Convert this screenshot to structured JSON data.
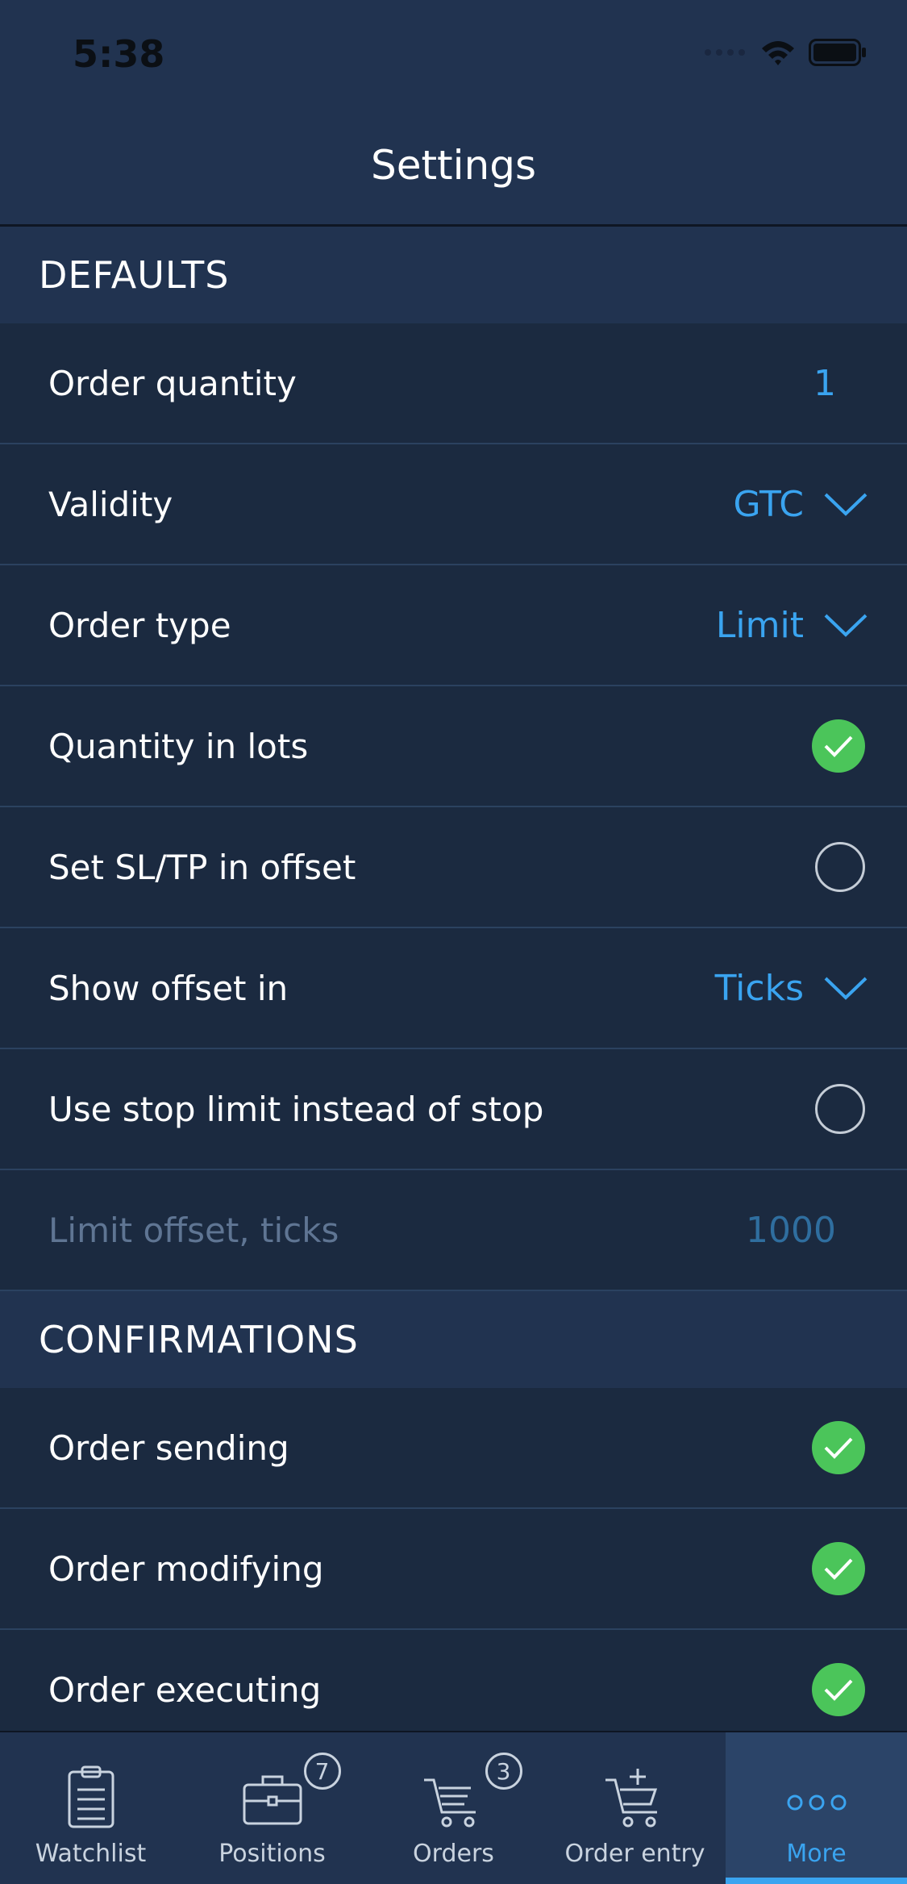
{
  "status_bar": {
    "time": "5:38"
  },
  "nav": {
    "title": "Settings"
  },
  "sections": {
    "defaults": {
      "title": "DEFAULTS",
      "rows": [
        {
          "label": "Order quantity",
          "value": "1"
        },
        {
          "label": "Validity",
          "value": "GTC"
        },
        {
          "label": "Order type",
          "value": "Limit"
        },
        {
          "label": "Quantity in lots",
          "checked": true
        },
        {
          "label": "Set SL/TP in offset",
          "checked": false
        },
        {
          "label": "Show offset in",
          "value": "Ticks"
        },
        {
          "label": "Use stop limit instead of stop",
          "checked": false
        },
        {
          "label": "Limit offset, ticks",
          "value": "1000",
          "disabled": true
        }
      ]
    },
    "confirmations": {
      "title": "CONFIRMATIONS",
      "rows": [
        {
          "label": "Order sending",
          "checked": true
        },
        {
          "label": "Order modifying",
          "checked": true
        },
        {
          "label": "Order executing",
          "checked": true
        }
      ]
    }
  },
  "tab_bar": {
    "tabs": [
      {
        "label": "Watchlist",
        "icon": "clipboard-icon"
      },
      {
        "label": "Positions",
        "icon": "briefcase-icon",
        "badge": "7"
      },
      {
        "label": "Orders",
        "icon": "cart-icon",
        "badge": "3"
      },
      {
        "label": "Order entry",
        "icon": "cart-add-icon"
      },
      {
        "label": "More",
        "icon": "more-dots-icon",
        "active": true
      }
    ]
  },
  "colors": {
    "accent": "#3aa4f0",
    "check_green": "#4bc55a",
    "background": "#1b2a40",
    "header_bg": "#213350"
  }
}
